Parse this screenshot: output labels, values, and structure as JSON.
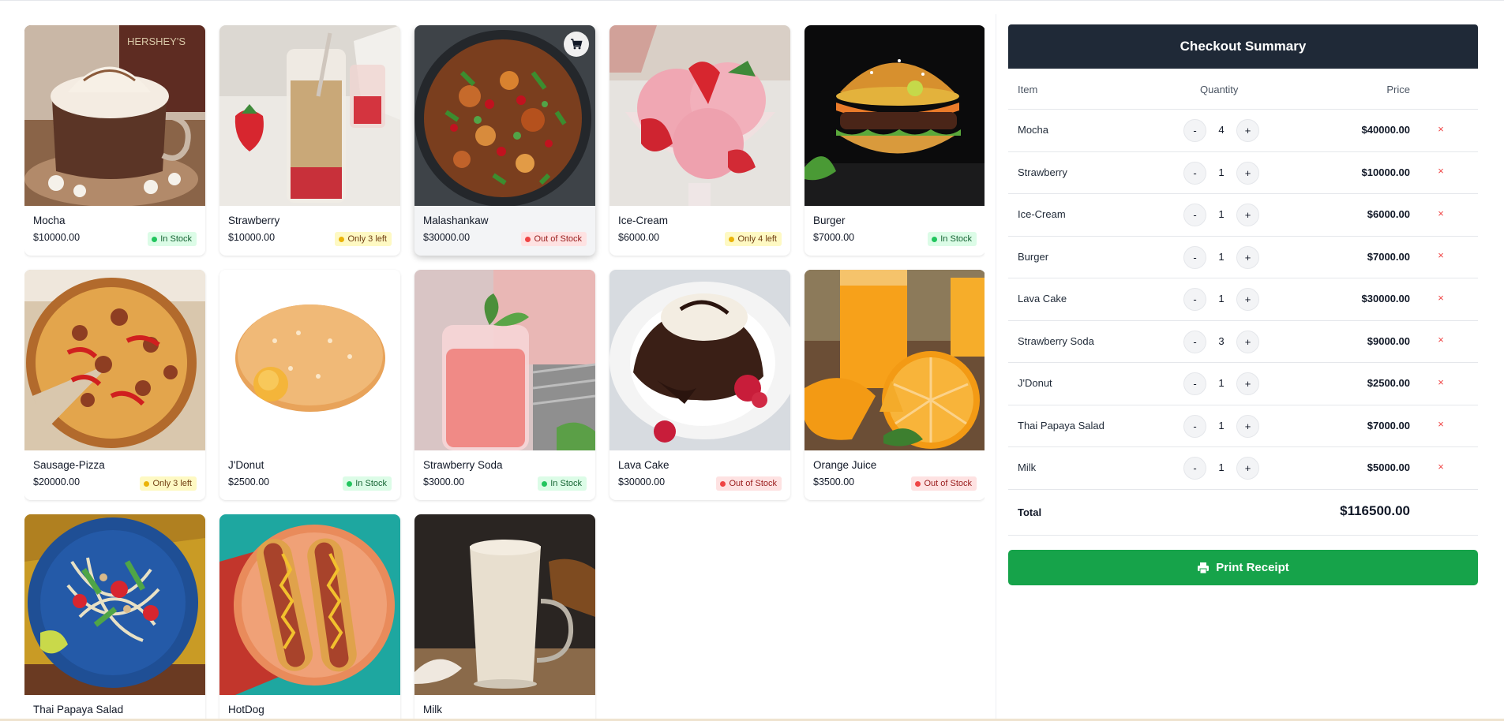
{
  "products": [
    {
      "name": "Mocha",
      "price": "$10000.00",
      "stock": "In Stock",
      "status": "in"
    },
    {
      "name": "Strawberry",
      "price": "$10000.00",
      "stock": "Only 3 left",
      "status": "few"
    },
    {
      "name": "Malashankaw",
      "price": "$30000.00",
      "stock": "Out of Stock",
      "status": "out"
    },
    {
      "name": "Ice-Cream",
      "price": "$6000.00",
      "stock": "Only 4 left",
      "status": "few"
    },
    {
      "name": "Burger",
      "price": "$7000.00",
      "stock": "In Stock",
      "status": "in"
    },
    {
      "name": "Sausage-Pizza",
      "price": "$20000.00",
      "stock": "Only 3 left",
      "status": "few"
    },
    {
      "name": "J'Donut",
      "price": "$2500.00",
      "stock": "In Stock",
      "status": "in"
    },
    {
      "name": "Strawberry Soda",
      "price": "$3000.00",
      "stock": "In Stock",
      "status": "in"
    },
    {
      "name": "Lava Cake",
      "price": "$30000.00",
      "stock": "Out of Stock",
      "status": "out"
    },
    {
      "name": "Orange Juice",
      "price": "$3500.00",
      "stock": "Out of Stock",
      "status": "out"
    },
    {
      "name": "Thai Papaya Salad",
      "price": "",
      "stock": "",
      "status": ""
    },
    {
      "name": "HotDog",
      "price": "",
      "stock": "",
      "status": ""
    },
    {
      "name": "Milk",
      "price": "",
      "stock": "",
      "status": ""
    }
  ],
  "summary": {
    "title": "Checkout Summary",
    "columns": {
      "item": "Item",
      "quantity": "Quantity",
      "price": "Price"
    },
    "items": [
      {
        "name": "Mocha",
        "qty": "4",
        "price": "$40000.00"
      },
      {
        "name": "Strawberry",
        "qty": "1",
        "price": "$10000.00"
      },
      {
        "name": "Ice-Cream",
        "qty": "1",
        "price": "$6000.00"
      },
      {
        "name": "Burger",
        "qty": "1",
        "price": "$7000.00"
      },
      {
        "name": "Lava Cake",
        "qty": "1",
        "price": "$30000.00"
      },
      {
        "name": "Strawberry Soda",
        "qty": "3",
        "price": "$9000.00"
      },
      {
        "name": "J'Donut",
        "qty": "1",
        "price": "$2500.00"
      },
      {
        "name": "Thai Papaya Salad",
        "qty": "1",
        "price": "$7000.00"
      },
      {
        "name": "Milk",
        "qty": "1",
        "price": "$5000.00"
      }
    ],
    "minus": "-",
    "plus": "+",
    "remove": "×",
    "total_label": "Total",
    "total_value": "$116500.00",
    "print_label": "Print Receipt"
  },
  "icons": {
    "cart": "cart-icon",
    "printer": "printer-icon"
  },
  "colors": {
    "header": "#1f2937",
    "print_button": "#16a34a",
    "in_stock": "#22c55e",
    "few_left": "#eab308",
    "out_of_stock": "#ef4444"
  }
}
